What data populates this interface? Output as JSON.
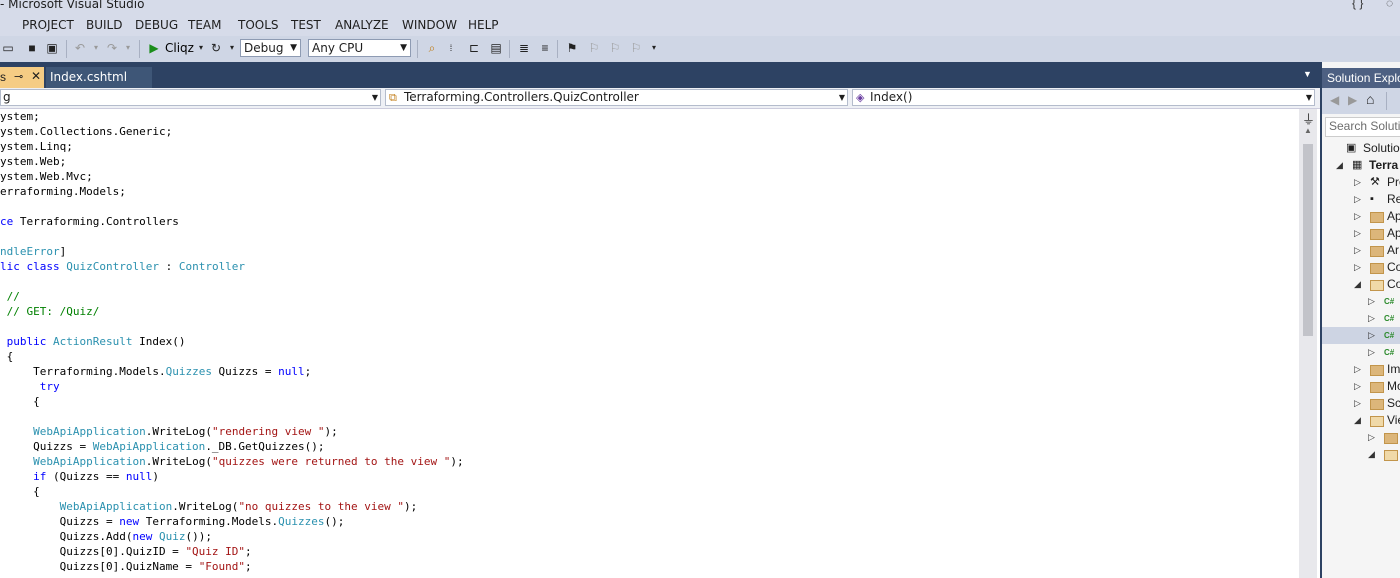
{
  "window": {
    "title": "- Microsoft Visual Studio"
  },
  "menubar": [
    "PROJECT",
    "BUILD",
    "DEBUG",
    "TEAM",
    "TOOLS",
    "TEST",
    "ANALYZE",
    "WINDOW",
    "HELP"
  ],
  "toolbar": {
    "run_label": "Cliqz",
    "config": "Debug",
    "platform": "Any CPU"
  },
  "tabs": [
    {
      "label": "s",
      "active": true,
      "pinned": true
    },
    {
      "label": "Index.cshtml",
      "active": false
    }
  ],
  "navbar": {
    "project": "g",
    "type": "Terraforming.Controllers.QuizController",
    "member": "Index()"
  },
  "code_lines": [
    [
      {
        "t": "ystem;"
      }
    ],
    [
      {
        "t": "ystem.Collections.Generic;"
      }
    ],
    [
      {
        "t": "ystem.Linq;"
      }
    ],
    [
      {
        "t": "ystem.Web;"
      }
    ],
    [
      {
        "t": "ystem.Web.Mvc;"
      }
    ],
    [
      {
        "t": "erraforming.Models;"
      }
    ],
    [],
    [
      {
        "t": "ce",
        "c": "kw"
      },
      {
        "t": " Terraforming.Controllers"
      }
    ],
    [],
    [
      {
        "t": "ndleError",
        "c": "ty"
      },
      {
        "t": "]"
      }
    ],
    [
      {
        "t": "lic class",
        "c": "kw"
      },
      {
        "t": " "
      },
      {
        "t": "QuizController",
        "c": "ty"
      },
      {
        "t": " : "
      },
      {
        "t": "Controller",
        "c": "ty"
      }
    ],
    [],
    [
      {
        "t": " //",
        "c": "cm"
      }
    ],
    [
      {
        "t": " // GET: /Quiz/",
        "c": "cm"
      }
    ],
    [],
    [
      {
        "t": " "
      },
      {
        "t": "public",
        "c": "kw"
      },
      {
        "t": " "
      },
      {
        "t": "ActionResult",
        "c": "ty"
      },
      {
        "t": " Index()"
      }
    ],
    [
      {
        "t": " {"
      }
    ],
    [
      {
        "t": "     Terraforming.Models."
      },
      {
        "t": "Quizzes",
        "c": "ty"
      },
      {
        "t": " Quizzs = "
      },
      {
        "t": "null",
        "c": "kw"
      },
      {
        "t": ";"
      }
    ],
    [
      {
        "t": "      "
      },
      {
        "t": "try",
        "c": "kw"
      }
    ],
    [
      {
        "t": "     {"
      }
    ],
    [],
    [
      {
        "t": "     "
      },
      {
        "t": "WebApiApplication",
        "c": "ty"
      },
      {
        "t": ".WriteLog("
      },
      {
        "t": "\"rendering view \"",
        "c": "st"
      },
      {
        "t": ");"
      }
    ],
    [
      {
        "t": "     Quizzs = "
      },
      {
        "t": "WebApiApplication",
        "c": "ty"
      },
      {
        "t": "._DB.GetQuizzes();"
      }
    ],
    [
      {
        "t": "     "
      },
      {
        "t": "WebApiApplication",
        "c": "ty"
      },
      {
        "t": ".WriteLog("
      },
      {
        "t": "\"quizzes were returned to the view \"",
        "c": "st"
      },
      {
        "t": ");"
      }
    ],
    [
      {
        "t": "     "
      },
      {
        "t": "if",
        "c": "kw"
      },
      {
        "t": " (Quizzs == "
      },
      {
        "t": "null",
        "c": "kw"
      },
      {
        "t": ")"
      }
    ],
    [
      {
        "t": "     {"
      }
    ],
    [
      {
        "t": "         "
      },
      {
        "t": "WebApiApplication",
        "c": "ty"
      },
      {
        "t": ".WriteLog("
      },
      {
        "t": "\"no quizzes to the view \"",
        "c": "st"
      },
      {
        "t": ");"
      }
    ],
    [
      {
        "t": "         Quizzs = "
      },
      {
        "t": "new",
        "c": "kw"
      },
      {
        "t": " Terraforming.Models."
      },
      {
        "t": "Quizzes",
        "c": "ty"
      },
      {
        "t": "();"
      }
    ],
    [
      {
        "t": "         Quizzs.Add("
      },
      {
        "t": "new",
        "c": "kw"
      },
      {
        "t": " "
      },
      {
        "t": "Quiz",
        "c": "ty"
      },
      {
        "t": "());"
      }
    ],
    [
      {
        "t": "         Quizzs[0].QuizID = "
      },
      {
        "t": "\"Quiz ID\"",
        "c": "st"
      },
      {
        "t": ";"
      }
    ],
    [
      {
        "t": "         Quizzs[0].QuizName = "
      },
      {
        "t": "\"Found\"",
        "c": "st"
      },
      {
        "t": ";"
      }
    ]
  ],
  "solution_explorer": {
    "title": "Solution Explor",
    "search_placeholder": "Search Solution",
    "items": [
      {
        "label": "Solution ",
        "exp": "",
        "icon": "solution"
      },
      {
        "label": "Terra",
        "exp": "open",
        "icon": "project",
        "bold": true
      },
      {
        "label": "Pro",
        "exp": "closed",
        "icon": "wrench"
      },
      {
        "label": "Re",
        "exp": "closed",
        "icon": "ref"
      },
      {
        "label": "Ap",
        "exp": "closed",
        "icon": "folder"
      },
      {
        "label": "Ap",
        "exp": "closed",
        "icon": "folder"
      },
      {
        "label": "Ar",
        "exp": "closed",
        "icon": "folder"
      },
      {
        "label": "Co",
        "exp": "closed",
        "icon": "folder"
      },
      {
        "label": "Co",
        "exp": "open",
        "icon": "folder-open"
      },
      {
        "label": "",
        "exp": "closed",
        "icon": "cs"
      },
      {
        "label": "",
        "exp": "closed",
        "icon": "cs"
      },
      {
        "label": "",
        "exp": "closed",
        "icon": "cs",
        "selected": true
      },
      {
        "label": "",
        "exp": "closed",
        "icon": "cs"
      },
      {
        "label": "Im",
        "exp": "closed",
        "icon": "folder"
      },
      {
        "label": "Mo",
        "exp": "closed",
        "icon": "folder"
      },
      {
        "label": "Sc",
        "exp": "closed",
        "icon": "folder"
      },
      {
        "label": "Vie",
        "exp": "open",
        "icon": "folder-open"
      },
      {
        "label": "",
        "exp": "closed",
        "icon": "folder"
      },
      {
        "label": "",
        "exp": "open",
        "icon": "folder-open"
      }
    ]
  }
}
